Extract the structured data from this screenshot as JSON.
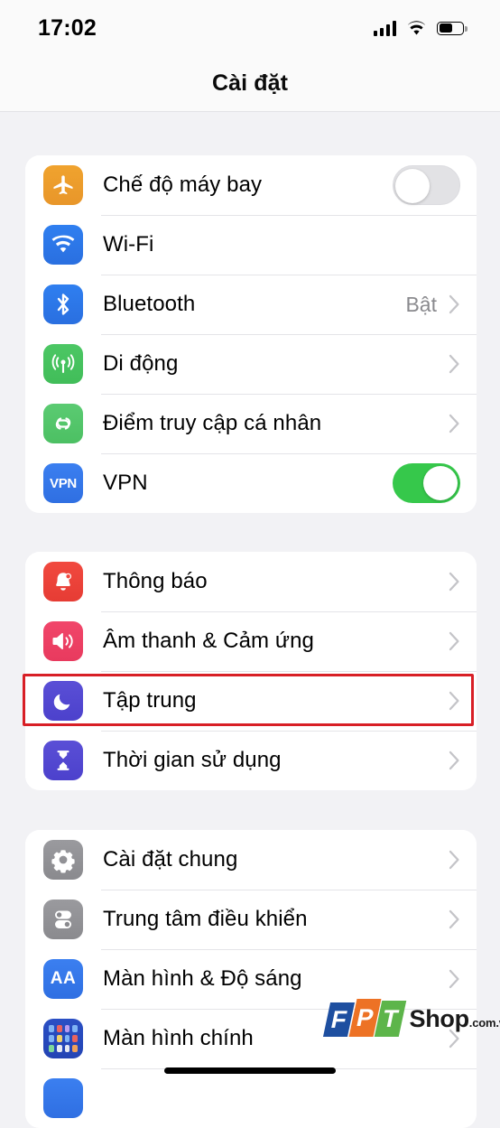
{
  "status_bar": {
    "time": "17:02",
    "signal_icon": "cellular-signal-icon",
    "wifi_icon": "wifi-icon",
    "battery_icon": "battery-icon",
    "battery_level_percent": 53
  },
  "navbar": {
    "title": "Cài đặt"
  },
  "groups": [
    {
      "id": "connectivity",
      "rows": [
        {
          "label": "Chế độ máy bay",
          "icon": "airplane-icon",
          "control": "toggle",
          "toggle_on": false
        },
        {
          "label": "Wi-Fi",
          "icon": "wifi-icon",
          "control": "none"
        },
        {
          "label": "Bluetooth",
          "icon": "bluetooth-icon",
          "control": "chevron",
          "value": "Bật"
        },
        {
          "label": "Di động",
          "icon": "cellular-icon",
          "control": "chevron",
          "value": ""
        },
        {
          "label": "Điểm truy cập cá nhân",
          "icon": "personal-hotspot-icon",
          "control": "chevron",
          "value": ""
        },
        {
          "label": "VPN",
          "icon": "vpn-icon",
          "control": "toggle",
          "toggle_on": true
        }
      ]
    },
    {
      "id": "alerts",
      "rows": [
        {
          "label": "Thông báo",
          "icon": "bell-icon",
          "control": "chevron",
          "value": ""
        },
        {
          "label": "Âm thanh & Cảm ứng",
          "icon": "speaker-icon",
          "control": "chevron",
          "value": ""
        },
        {
          "label": "Tập trung",
          "icon": "moon-icon",
          "control": "chevron",
          "value": "",
          "highlighted": true
        },
        {
          "label": "Thời gian sử dụng",
          "icon": "hourglass-icon",
          "control": "chevron",
          "value": ""
        }
      ]
    },
    {
      "id": "system",
      "rows": [
        {
          "label": "Cài đặt chung",
          "icon": "gear-icon",
          "control": "chevron",
          "value": ""
        },
        {
          "label": "Trung tâm điều khiển",
          "icon": "control-center-icon",
          "control": "chevron",
          "value": ""
        },
        {
          "label": "Màn hình & Độ sáng",
          "icon": "display-brightness-icon",
          "control": "chevron",
          "value": ""
        },
        {
          "label": "Màn hình chính",
          "icon": "home-screen-icon",
          "control": "chevron",
          "value": ""
        }
      ]
    }
  ],
  "watermark": {
    "f": "F",
    "p": "P",
    "t": "T",
    "shop": "Shop",
    "domain": ".com.vn"
  },
  "colors": {
    "page_background": "#f2f2f5",
    "card_background": "#ffffff",
    "highlight_red": "#d81f26",
    "toggle_on_green": "#36c84b",
    "toggle_off_gray": "#e2e2e5",
    "secondary_text": "#8a8a8e",
    "chevron_gray": "#c4c4c8"
  }
}
